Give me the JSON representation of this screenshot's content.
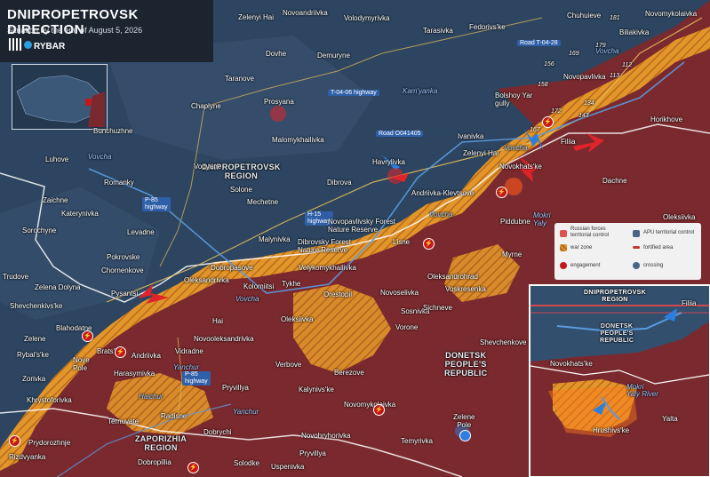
{
  "header": {
    "title": "DNIPROPETROVSK DIRECTION",
    "subtitle": "Situation by the end of August 5, 2026",
    "brand": "RYBAR"
  },
  "regions": {
    "dnipropetrovsk": "DNIPROPETROVSK\nREGION",
    "donetsk": "DONETSK\nPEOPLE'S\nREPUBLIC",
    "zaporizhia": "ZAPORIZHIA\nREGION"
  },
  "rivers": {
    "vovcha1": "Vovcha",
    "vovcha2": "Vovcha",
    "vovcha3": "Vovcha",
    "vovcha4": "Vovcha",
    "kamyanka": "Kam'yanka",
    "yanchur1": "Yanchur",
    "yanchur2": "Yanchur",
    "haichur": "Haichur",
    "mokri_yaly": "Mokri\nYaly",
    "vovcha5": "Vovcha"
  },
  "roads": {
    "t0406": "T-04-06 highway",
    "t0428": "Road T-04-28",
    "o041405": "Road O041405",
    "p85a": "P-85\nhighway",
    "h15": "H-15\nhighway",
    "p85b": "P-85\nhighway"
  },
  "features": {
    "bolshoy_yar": "Bolshoy Yar\ngully",
    "novopavlivsky": "Novopavlivsky Forest\nNature Reserve",
    "dibrovsky": "Dibrovsky Forest\nNature Reserve"
  },
  "settlements": {
    "zelenyi_hai_n": "Zelenyi Hai",
    "novoandriivka": "Novoandriivka",
    "volodymyrivka": "Volodymyrivka",
    "tarasivka": "Tarasivka",
    "fedorivske": "Fedorivs'ke",
    "chuhuieve": "Chuhuieve",
    "biliakivka": "Biliakivka",
    "novomykolaivka_n": "Novomykolaivka",
    "dovhe": "Dovhe",
    "demuryne": "Demuryne",
    "taranove": "Taranove",
    "prosyana": "Prosyana",
    "chaplyne": "Chaplyne",
    "malomykhailivka": "Malomykhailivka",
    "bunchuzhne": "Bunchuzhne",
    "novopavlivka": "Novopavlivka",
    "horikhove": "Horikhove",
    "ivanivka": "Ivanivka",
    "filiia": "Filiia",
    "luhove": "Luhove",
    "vodyane": "Vodyane",
    "havrylivka": "Havrylivka",
    "zelenyi_hai": "Zelenyi Hai",
    "novokhatske": "Novokhats'ke",
    "romanky": "Romanky",
    "dibrova": "Dibrova",
    "andriivka_klevtsove": "Andriivka-Klevtsove",
    "dachne": "Dachne",
    "zaichne": "Zaichne",
    "solone": "Solone",
    "katerynivka": "Katerynivka",
    "mechetne": "Mechetne",
    "piddubne": "Piddubne",
    "oleksiivka_e": "Oleksiivka",
    "levadne": "Levadne",
    "sorochyne": "Sorochyne",
    "malynivka": "Malynivka",
    "lisne": "Lisne",
    "myrne": "Myrne",
    "pokrovske": "Pokrovske",
    "chornenkove": "Chornenkove",
    "dobropasove": "Dobropasove",
    "velykomykhailivka": "Velykomykhailivka",
    "trudove": "Trudove",
    "zelena_dolyna": "Zelena Dolyna",
    "oleksandrivka": "Oleksandrivka",
    "kolomiitsi": "Kolomiitsi",
    "tykhe": "Tykhe",
    "orestopil": "Orestopil",
    "novoselivka": "Novoselivka",
    "oleksandrohrad": "Oleksandrohrad",
    "voskresenka": "Voskresenka",
    "pysantsi": "Pysantsi",
    "shevchenkivske": "Shevchenkivs'ke",
    "sosnivka": "Sosnivka",
    "sichneve": "Sichneve",
    "hai": "Hai",
    "oleksiivka": "Oleksiivka",
    "vorone": "Vorone",
    "zelene": "Zelene",
    "blahodatne": "Blahodatne",
    "novooleksandrivka": "Novooleksandrivka",
    "shevchenkove": "Shevchenkove",
    "rybalske": "Rybal's'ke",
    "bratske": "Brats'ke",
    "andriivka": "Andriivka",
    "vidradne": "Vidradne",
    "nove_pole": "Nove\nPole",
    "verbove": "Verbove",
    "berezove": "Berezove",
    "zorivka": "Zorivka",
    "harasymivka": "Harasymivka",
    "kalynivske": "Kalynivs'ke",
    "khrystoforivka": "Khrystoforivka",
    "pryvillya_w": "Pryvillya",
    "novomykolaivka": "Novomykolaivka",
    "radisne": "Radisne",
    "ternuvate": "Ternuvate",
    "zelene_pole": "Zelene\nPole",
    "prydorozhnje": "Prydorozhnje",
    "dobrychi": "Dobrychi",
    "novohryhorivka": "Novohryhorivka",
    "temyrivka": "Temyrivka",
    "rizdvyanka": "Rizdvyanka",
    "dobropillia": "Dobropillia",
    "solodke": "Solodke",
    "pryvillya": "Pryvillya",
    "uspenivka": "Uspenivka"
  },
  "numbers": [
    "181",
    "179",
    "169",
    "156",
    "158",
    "112",
    "113",
    "134",
    "143",
    "172",
    "167"
  ],
  "legend": {
    "russian": "Russian forces\nterritorial control",
    "apu": "APU territorial control",
    "war_zone": "war zone",
    "fortified": "fortified area",
    "engagement": "engagement",
    "crossing": "crossing"
  },
  "zoom": {
    "region_label": "DNIPROPETROVSK\nREGION",
    "dpr_label": "DONETSK\nPEOPLE'S\nREPUBLIC",
    "filiia": "Filiia",
    "novokhatske": "Novokhats'ke",
    "mokri_yaly": "Mokri\nYaly River",
    "yalta": "Yalta",
    "hrushivske": "Hrushivs'ke"
  },
  "colors": {
    "apu": "#2a3e56",
    "russian": "#7a2a2e",
    "war_zone": "#e2962a",
    "engagement": "#c21a1a",
    "arrow_red": "#e0242a",
    "arrow_blue": "#2b7fe0"
  }
}
